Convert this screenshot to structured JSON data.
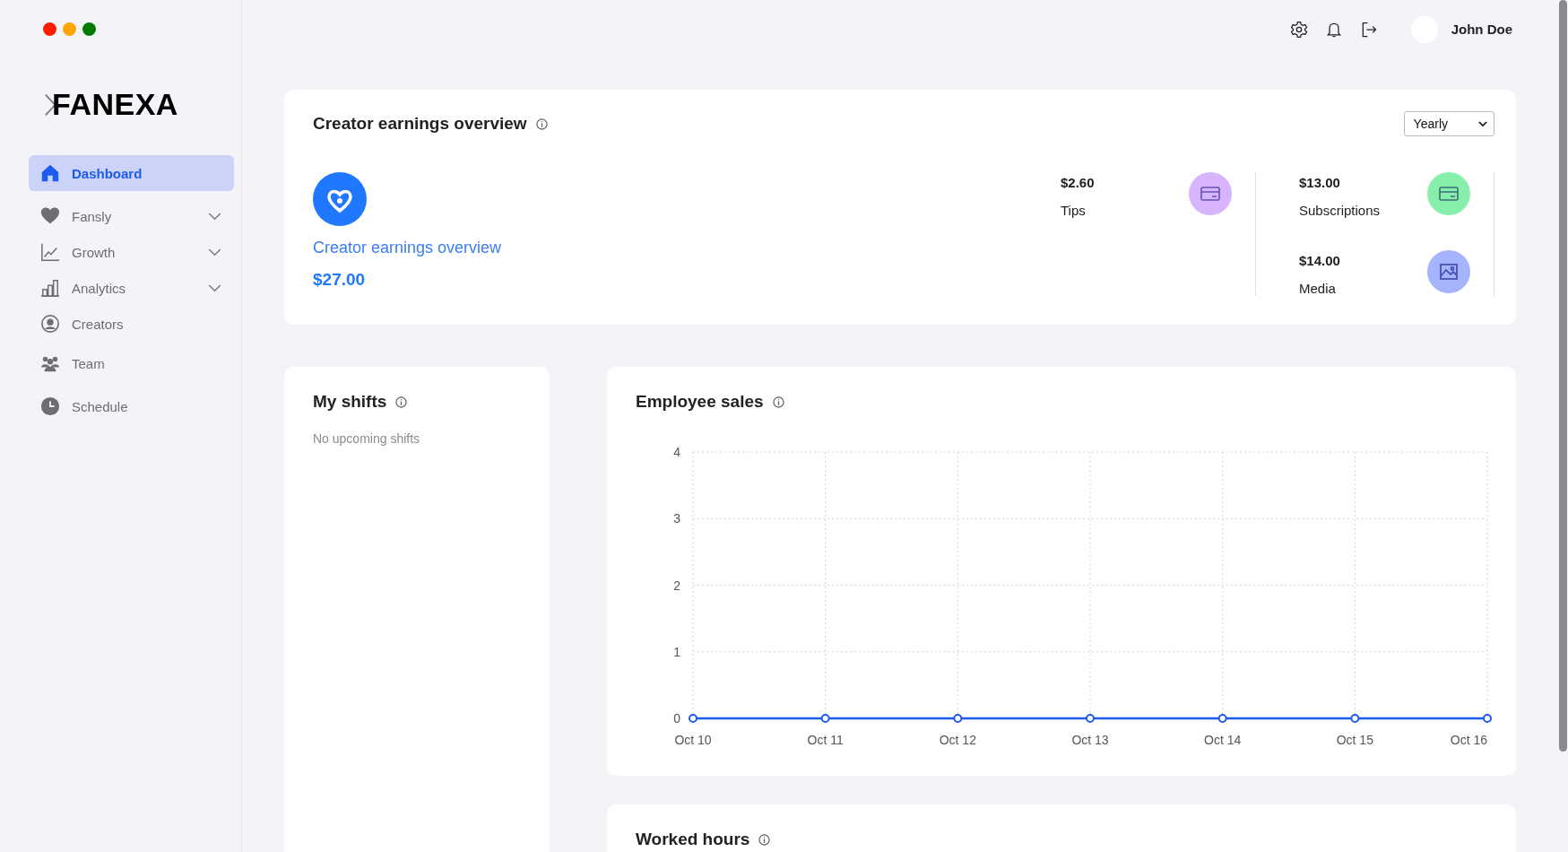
{
  "window_controls": [
    {
      "color": "#ff1a00"
    },
    {
      "color": "#ffa500"
    },
    {
      "color": "#007a00"
    }
  ],
  "logo": "FANEXA",
  "sidebar": {
    "items": [
      {
        "label": "Dashboard",
        "selected": true,
        "has_submenu": false
      },
      {
        "label": "Fansly",
        "selected": false,
        "has_submenu": true
      },
      {
        "label": "Growth",
        "selected": false,
        "has_submenu": true
      },
      {
        "label": "Analytics",
        "selected": false,
        "has_submenu": true
      },
      {
        "label": "Creators",
        "selected": false,
        "has_submenu": false
      },
      {
        "label": "Team",
        "selected": false,
        "has_submenu": false
      },
      {
        "label": "Schedule",
        "selected": false,
        "has_submenu": false
      }
    ]
  },
  "header": {
    "user_name": "John Doe"
  },
  "earnings": {
    "title": "Creator earnings overview",
    "period": "Yearly",
    "link": "Creator earnings overview",
    "total": "$27.00",
    "stat_columns": [
      [
        {
          "amount": "$2.60",
          "label": "Tips",
          "kind": "card",
          "color": "#d8b4fe"
        }
      ],
      [
        {
          "amount": "$13.00",
          "label": "Subscriptions",
          "kind": "card",
          "color": "#86efac"
        },
        {
          "amount": "$14.00",
          "label": "Media",
          "kind": "image",
          "color": "#a5b4fc"
        }
      ]
    ]
  },
  "shifts": {
    "title": "My shifts",
    "empty_text": "No upcoming shifts"
  },
  "employee_sales": {
    "title": "Employee sales",
    "chart_data": {
      "type": "line",
      "categories": [
        "Oct 10",
        "Oct 11",
        "Oct 12",
        "Oct 13",
        "Oct 14",
        "Oct 15",
        "Oct 16"
      ],
      "series": [
        {
          "color": "#1d5bf0",
          "marker": "circle",
          "values": [
            0,
            0,
            0,
            0,
            0,
            0,
            0
          ]
        }
      ],
      "grid": true,
      "ylim": [
        0,
        4
      ],
      "yticks": [
        0,
        1,
        2,
        3,
        4
      ]
    }
  },
  "worked_hours": {
    "title": "Worked hours"
  }
}
